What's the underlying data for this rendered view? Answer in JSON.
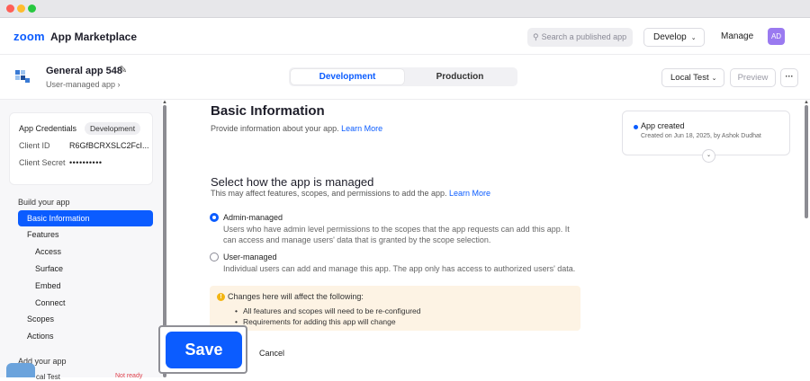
{
  "header": {
    "logo_zoom": "zoom",
    "logo_marketplace": "App Marketplace",
    "search_placeholder": "Search a published app",
    "develop_label": "Develop",
    "manage_label": "Manage",
    "avatar_initials": "AD"
  },
  "app": {
    "name": "General app 548",
    "subtitle": "User-managed app",
    "tabs": {
      "development": "Development",
      "production": "Production"
    },
    "local_test": "Local Test",
    "preview": "Preview",
    "more": "···"
  },
  "sidebar": {
    "credentials": {
      "title": "App Credentials",
      "badge": "Development",
      "client_id_label": "Client ID",
      "client_id_value": "R6GfBCRXSLC2FcI...",
      "client_secret_label": "Client Secret",
      "client_secret_value": "••••••••••"
    },
    "build_header": "Build your app",
    "items": [
      {
        "label": "Basic Information",
        "active": true
      },
      {
        "label": "Features"
      },
      {
        "label": "Access"
      },
      {
        "label": "Surface"
      },
      {
        "label": "Embed"
      },
      {
        "label": "Connect"
      },
      {
        "label": "Scopes"
      },
      {
        "label": "Actions"
      }
    ],
    "add_header": "Add your app",
    "add_item_partial": "cal Test",
    "add_item_status": "Not ready"
  },
  "main": {
    "title": "Basic Information",
    "description": "Provide information about your app.",
    "learn_more": "Learn More",
    "status": {
      "title": "App created",
      "subtitle": "Created on Jun 18, 2025, by Ashok Dudhat"
    },
    "manage_title": "Select how the app is managed",
    "manage_desc": "This may affect features, scopes, and permissions to add the app.",
    "options": [
      {
        "title": "Admin-managed",
        "desc": "Users who have admin level permissions to the scopes that the app requests can add this app. It can access and manage users' data that is granted by the scope selection.",
        "checked": true
      },
      {
        "title": "User-managed",
        "desc": "Individual users can add and manage this app. The app only has access to authorized users' data.",
        "checked": false
      }
    ],
    "warning": {
      "title": "Changes here will affect the following:",
      "items": [
        "All features and scopes will need to be re-configured",
        "Requirements for adding this app will change"
      ]
    },
    "save": "Save",
    "cancel": "Cancel"
  },
  "colors": {
    "accent": "#0b5cff",
    "warning_bg": "#fdf3e4",
    "avatar": "#9a7af0"
  }
}
